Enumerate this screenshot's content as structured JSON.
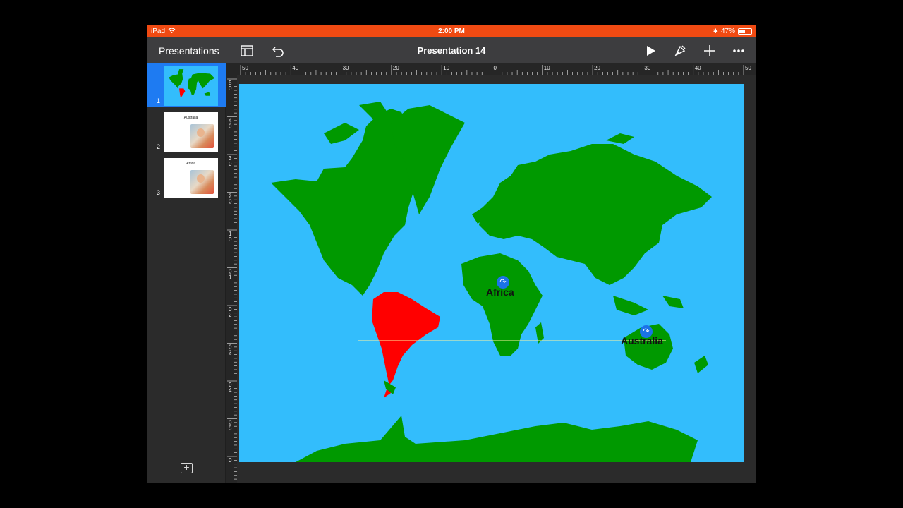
{
  "status": {
    "device": "iPad",
    "time": "2:00 PM",
    "battery": "47%",
    "battery_level": 0.47
  },
  "toolbar": {
    "back_label": "Presentations",
    "title": "Presentation 14"
  },
  "icons": {
    "layout": "sidebar-toggle-icon",
    "undo": "undo-icon",
    "play": "play-icon",
    "format": "paintbrush-icon",
    "add": "plus-icon",
    "more": "ellipsis-icon"
  },
  "slides": [
    {
      "num": "1",
      "title": ""
    },
    {
      "num": "2",
      "title": "Australia"
    },
    {
      "num": "3",
      "title": "Africa"
    }
  ],
  "ruler": {
    "h": [
      "50",
      "40",
      "30",
      "20",
      "10",
      "0",
      "10",
      "20",
      "30",
      "40",
      "50"
    ],
    "v": [
      "5",
      "0",
      "4",
      "0",
      "3",
      "0",
      "2",
      "0",
      "1",
      "0",
      "0",
      "1",
      "0",
      "2",
      "0",
      "3",
      "0",
      "4",
      "0",
      "5",
      "0"
    ]
  },
  "map": {
    "ocean_color": "#33bdfc",
    "land_color": "#009900",
    "highlight_color": "#ff0000",
    "labels": {
      "africa": "Africa",
      "australia": "Australia"
    }
  }
}
